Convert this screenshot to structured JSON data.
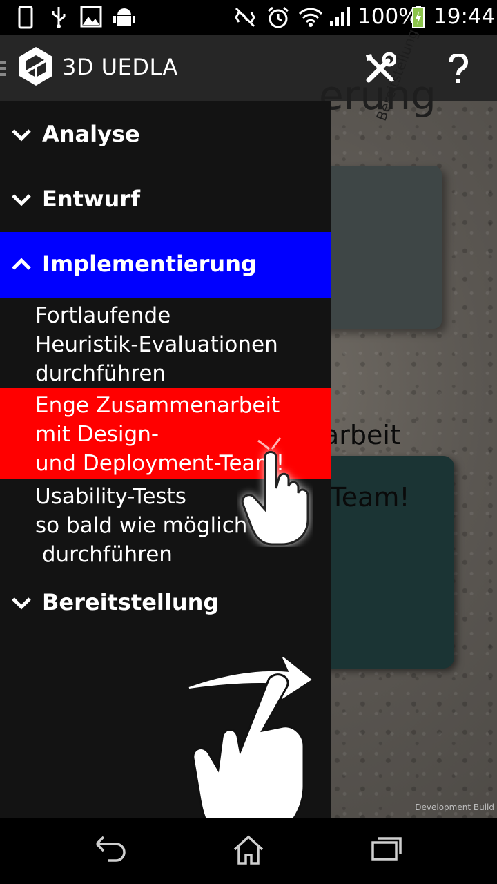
{
  "status_bar": {
    "battery_percent": "100%",
    "time": "19:44",
    "icons": [
      "phone-icon",
      "usb-icon",
      "image-icon",
      "android-icon",
      "nfc-off-icon",
      "alarm-icon",
      "wifi-icon",
      "signal-icon",
      "battery-charging-icon"
    ]
  },
  "action_bar": {
    "title": "3D UEDLA",
    "icons": [
      "unity-logo-icon",
      "tools-icon",
      "help-icon"
    ]
  },
  "drawer": {
    "sections": [
      {
        "label": "Analyse",
        "expanded": false
      },
      {
        "label": "Entwurf",
        "expanded": false
      },
      {
        "label": "Implementierung",
        "expanded": true
      },
      {
        "label": "Bereitstellung",
        "expanded": false
      }
    ],
    "items": [
      {
        "lines": [
          "Fortlaufende",
          "Heuristik-Evaluationen",
          "durchführen"
        ]
      },
      {
        "lines": [
          "Enge Zusammenarbeit",
          "mit Design-",
          "und Deployment-Team!"
        ]
      },
      {
        "lines": [
          "Usability-Tests",
          "so bald wie möglich",
          " durchführen"
        ]
      }
    ],
    "active_section_color": "#0000ff",
    "selected_item_color": "#ff0000"
  },
  "scene": {
    "card1_text": "erung",
    "card1_side_text": "Bereitstellung",
    "card2_line1": "arbeit",
    "card2_line2": "Team!",
    "watermark": "Development Build"
  },
  "nav_bar": {
    "icons": [
      "back-icon",
      "home-icon",
      "recent-apps-icon"
    ]
  }
}
